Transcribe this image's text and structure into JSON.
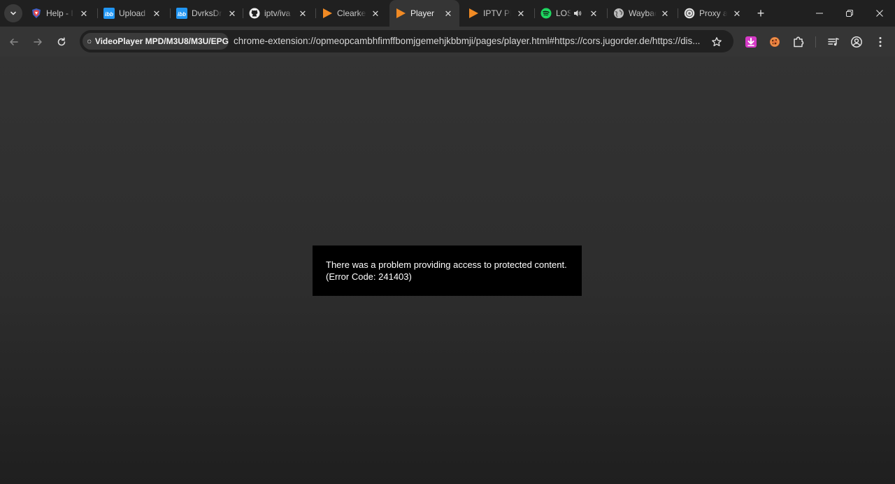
{
  "browser": {
    "tabs": [
      {
        "title": "Help - I",
        "favicon": "shield-badge-icon",
        "active": false
      },
      {
        "title": "Upload",
        "favicon": "ibb-icon",
        "active": false
      },
      {
        "title": "DvrksDr",
        "favicon": "ibb-icon",
        "active": false
      },
      {
        "title": "iptv/iva",
        "favicon": "github-icon",
        "active": false
      },
      {
        "title": "Clearke",
        "favicon": "play-triangle-icon",
        "active": false
      },
      {
        "title": "Player",
        "favicon": "play-triangle-icon",
        "active": true
      },
      {
        "title": "IPTV PL",
        "favicon": "play-triangle-icon",
        "active": false
      },
      {
        "title": "LOS",
        "favicon": "spotify-icon",
        "active": false,
        "audio": true
      },
      {
        "title": "Waybac",
        "favicon": "globe-icon",
        "active": false
      },
      {
        "title": "Proxy a",
        "favicon": "proxy-icon",
        "active": false
      }
    ],
    "new_tab_label": "+",
    "window_controls": [
      "minimize",
      "restore",
      "close"
    ],
    "site_chip_label": "VideoPlayer MPD/M3U8/M3U/EPG",
    "url": "chrome-extension://opmeopcambhfimffbomjgemehjkbbmji/pages/player.html#https://cors.jugorder.de/https://dis...",
    "colors": {
      "tabstrip_bg": "#202020",
      "toolbar_bg": "#353535",
      "omnibox_bg": "#202020",
      "accent_orange": "#f08a24",
      "spotify_green": "#1ed760",
      "ibb_blue": "#2196f3",
      "download_ext_magenta": "#d63ac7"
    }
  },
  "player": {
    "error_line1": "There was a problem providing access to protected content.",
    "error_line2": "(Error Code: 241403)"
  }
}
